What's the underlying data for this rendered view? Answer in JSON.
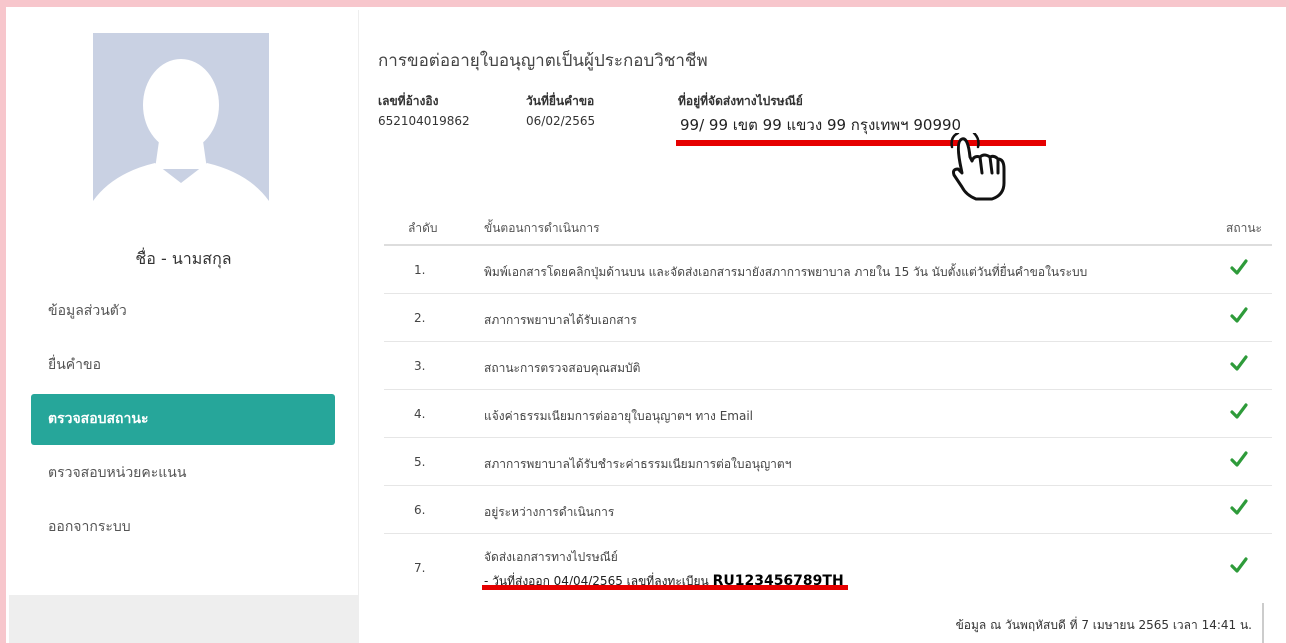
{
  "user": {
    "name": "ชื่อ - นามสกุล"
  },
  "sidebar": {
    "items": [
      {
        "label": "ข้อมูลส่วนตัว",
        "active": false
      },
      {
        "label": "ยื่นคำขอ",
        "active": false
      },
      {
        "label": "ตรวจสอบสถานะ",
        "active": true
      },
      {
        "label": "ตรวจสอบหน่วยคะแนน",
        "active": false
      },
      {
        "label": "ออกจากระบบ",
        "active": false
      }
    ]
  },
  "request": {
    "title": "การขอต่ออายุใบอนุญาตเป็นผู้ประกอบวิชาชีพ",
    "ref_label": "เลขที่อ้างอิง",
    "ref_value": "652104019862",
    "date_label": "วันที่ยื่นคำขอ",
    "date_value": "06/02/2565",
    "address_label": "ที่อยู่ที่จัดส่งทางไปรษณีย์",
    "address_value": "99/ 99 เขต 99 แขวง 99 กรุงเทพฯ 90990"
  },
  "table": {
    "headers": {
      "order": "ลำดับ",
      "step": "ขั้นตอนการดำเนินการ",
      "status": "สถานะ"
    },
    "rows": [
      {
        "num": "1.",
        "step": "พิมพ์เอกสารโดยคลิกปุ่มด้านบน และจัดส่งเอกสารมายังสภาการพยาบาล ภายใน 15 วัน นับตั้งแต่วันที่ยื่นคำขอในระบบ",
        "status": "check-icon"
      },
      {
        "num": "2.",
        "step": "สภาการพยาบาลได้รับเอกสาร",
        "status": "check-icon"
      },
      {
        "num": "3.",
        "step": "สถานะการตรวจสอบคุณสมบัติ",
        "status": "check-icon"
      },
      {
        "num": "4.",
        "step": "แจ้งค่าธรรมเนียมการต่ออายุใบอนุญาตฯ ทาง Email",
        "status": "check-icon"
      },
      {
        "num": "5.",
        "step": "สภาการพยาบาลได้รับชำระค่าธรรมเนียมการต่อใบอนุญาตฯ",
        "status": "check-icon"
      },
      {
        "num": "6.",
        "step": "อยู่ระหว่างการดำเนินการ",
        "status": "check-icon"
      }
    ],
    "last_row": {
      "num": "7.",
      "step": "จัดส่งเอกสารทางไปรษณีย์",
      "detail": "- วันที่ส่งออก 04/04/2565 เลขที่ลงทะเบียน",
      "tracking": "RU123456789TH",
      "status": "check-icon"
    }
  },
  "footer_note": "ข้อมูล ณ วันพฤหัสบดี ที่ 7 เมษายน 2565 เวลา 14:41 น.",
  "colors": {
    "accent": "#26a69a",
    "highlight": "#e60000",
    "check": "#2e9b3a",
    "border": "#f7c6cc",
    "avatar": "#c9d1e3"
  }
}
